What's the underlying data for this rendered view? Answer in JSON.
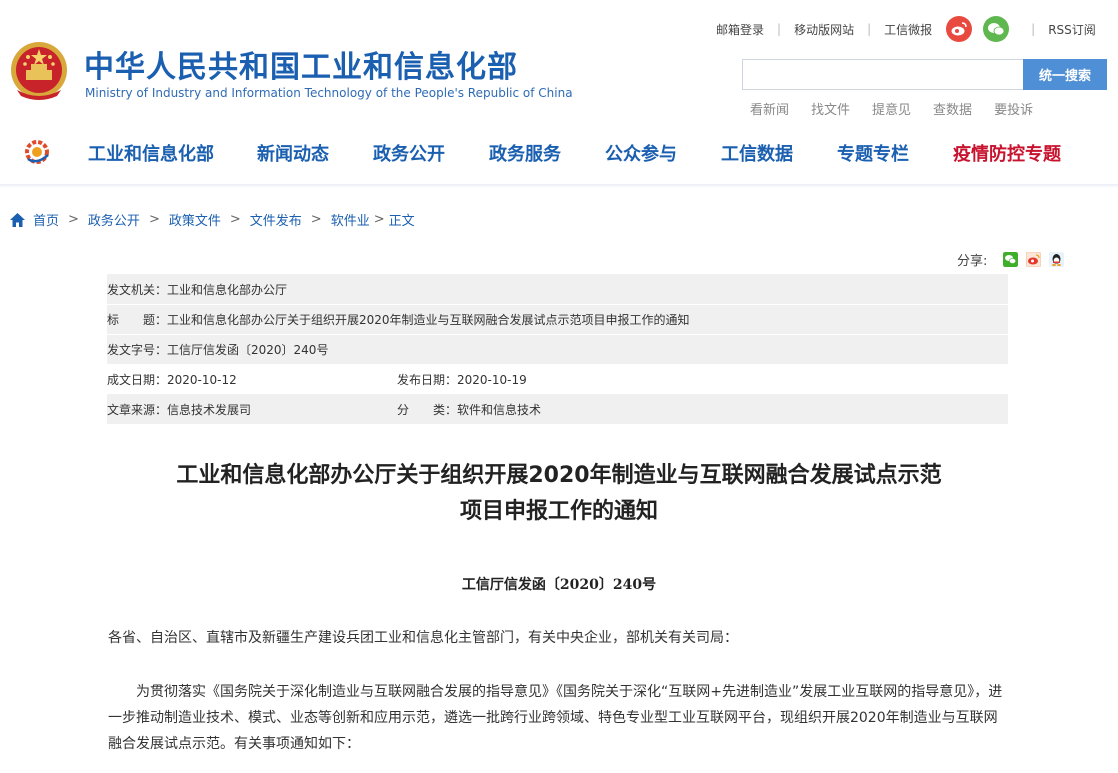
{
  "toplinks": {
    "mail_login": "邮箱登录",
    "mobile_site": "移动版网站",
    "miit_weibo": "工信微报",
    "rss": "RSS订阅",
    "weibo_icon": "weibo-icon",
    "wechat_icon": "wechat-icon"
  },
  "header": {
    "title_cn": "中华人民共和国工业和信息化部",
    "title_en": "Ministry of Industry and Information Technology of the People's Republic of China",
    "brand_color": "#1b5fb0"
  },
  "search": {
    "placeholder": "",
    "button": "统一搜索",
    "quicklinks": [
      "看新闻",
      "找文件",
      "提意见",
      "查数据",
      "要投诉"
    ]
  },
  "nav": {
    "items": [
      "工业和信息化部",
      "新闻动态",
      "政务公开",
      "政务服务",
      "公众参与",
      "工信数据",
      "专题专栏",
      "疫情防控专题"
    ],
    "highlight_color": "#c8132e"
  },
  "breadcrumb": [
    "首页",
    "政务公开",
    "政策文件",
    "文件发布",
    "软件业",
    "正文"
  ],
  "breadcrumb_seps": [
    ">",
    ">",
    ">",
    ">",
    ">"
  ],
  "share": {
    "label": "分享:",
    "icons": [
      "wechat-share-icon",
      "weibo-share-icon",
      "qq-share-icon"
    ]
  },
  "meta": {
    "issuer": "发文机关：工业和信息化部办公厅",
    "title": "标　　题：工业和信息化部办公厅关于组织开展2020年制造业与互联网融合发展试点示范项目申报工作的通知",
    "doc_number": "发文字号：工信厅信发函〔2020〕240号",
    "created_date": "成文日期：2020-10-12",
    "published_date": "发布日期：2020-10-19",
    "source": "文章来源：信息技术发展司",
    "category": "分　　类：软件和信息技术"
  },
  "article": {
    "title_line1": "工业和信息化部办公厅关于组织开展2020年制造业与互联网融合发展试点示范",
    "title_line2": "项目申报工作的通知",
    "doc_no": "工信厅信发函〔2020〕240号",
    "addressee": "各省、自治区、直辖市及新疆生产建设兵团工业和信息化主管部门，有关中央企业，部机关有关司局：",
    "para1": "为贯彻落实《国务院关于深化制造业与互联网融合发展的指导意见》《国务院关于深化“互联网+先进制造业”发展工业互联网的指导意见》，进一步推动制造业技术、模式、业态等创新和应用示范，遴选一批跨行业跨领域、特色专业型工业互联网平台，现组织开展2020年制造业与互联网融合发展试点示范。有关事项通知如下："
  }
}
